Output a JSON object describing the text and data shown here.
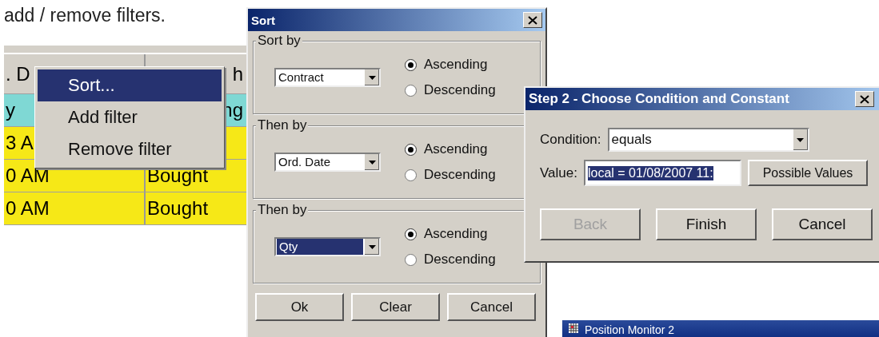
{
  "caption": "add / remove filters.",
  "grid": {
    "header": [
      ". D",
      "h"
    ],
    "rows": [
      {
        "color": "#7fd8d4",
        "cells": [
          "y",
          "ng"
        ]
      },
      {
        "color": "#f6e817",
        "cells": [
          "3 A",
          ""
        ]
      },
      {
        "color": "#f6e817",
        "cells": [
          "0 AM",
          "Bought"
        ]
      },
      {
        "color": "#f6e817",
        "cells": [
          "0 AM",
          "Bought"
        ]
      }
    ]
  },
  "context_menu": {
    "items": [
      {
        "label": "Sort...",
        "selected": true
      },
      {
        "label": "Add filter",
        "selected": false
      },
      {
        "label": "Remove filter",
        "selected": false
      }
    ]
  },
  "sort_dialog": {
    "title": "Sort",
    "groups": [
      {
        "legend": "Sort by",
        "field": "Contract",
        "field_selected": false,
        "options": [
          {
            "label": "Ascending",
            "selected": true
          },
          {
            "label": "Descending",
            "selected": false
          }
        ]
      },
      {
        "legend": "Then by",
        "field": "Ord. Date",
        "field_selected": false,
        "options": [
          {
            "label": "Ascending",
            "selected": true
          },
          {
            "label": "Descending",
            "selected": false
          }
        ]
      },
      {
        "legend": "Then by",
        "field": "Qty",
        "field_selected": true,
        "options": [
          {
            "label": "Ascending",
            "selected": true
          },
          {
            "label": "Descending",
            "selected": false
          }
        ]
      }
    ],
    "buttons": [
      "Ok",
      "Clear",
      "Cancel"
    ]
  },
  "condition_dialog": {
    "title": "Step 2 - Choose Condition and Constant",
    "condition_label": "Condition:",
    "condition": "equals",
    "value_label": "Value:",
    "value": "local = 01/08/2007 11:",
    "value_selected": true,
    "possible_values_button": "Possible Values",
    "buttons": [
      {
        "label": "Back",
        "disabled": true
      },
      {
        "label": "Finish",
        "disabled": false
      },
      {
        "label": "Cancel",
        "disabled": false
      }
    ]
  },
  "background_window": {
    "title": "Position Monitor 2"
  }
}
